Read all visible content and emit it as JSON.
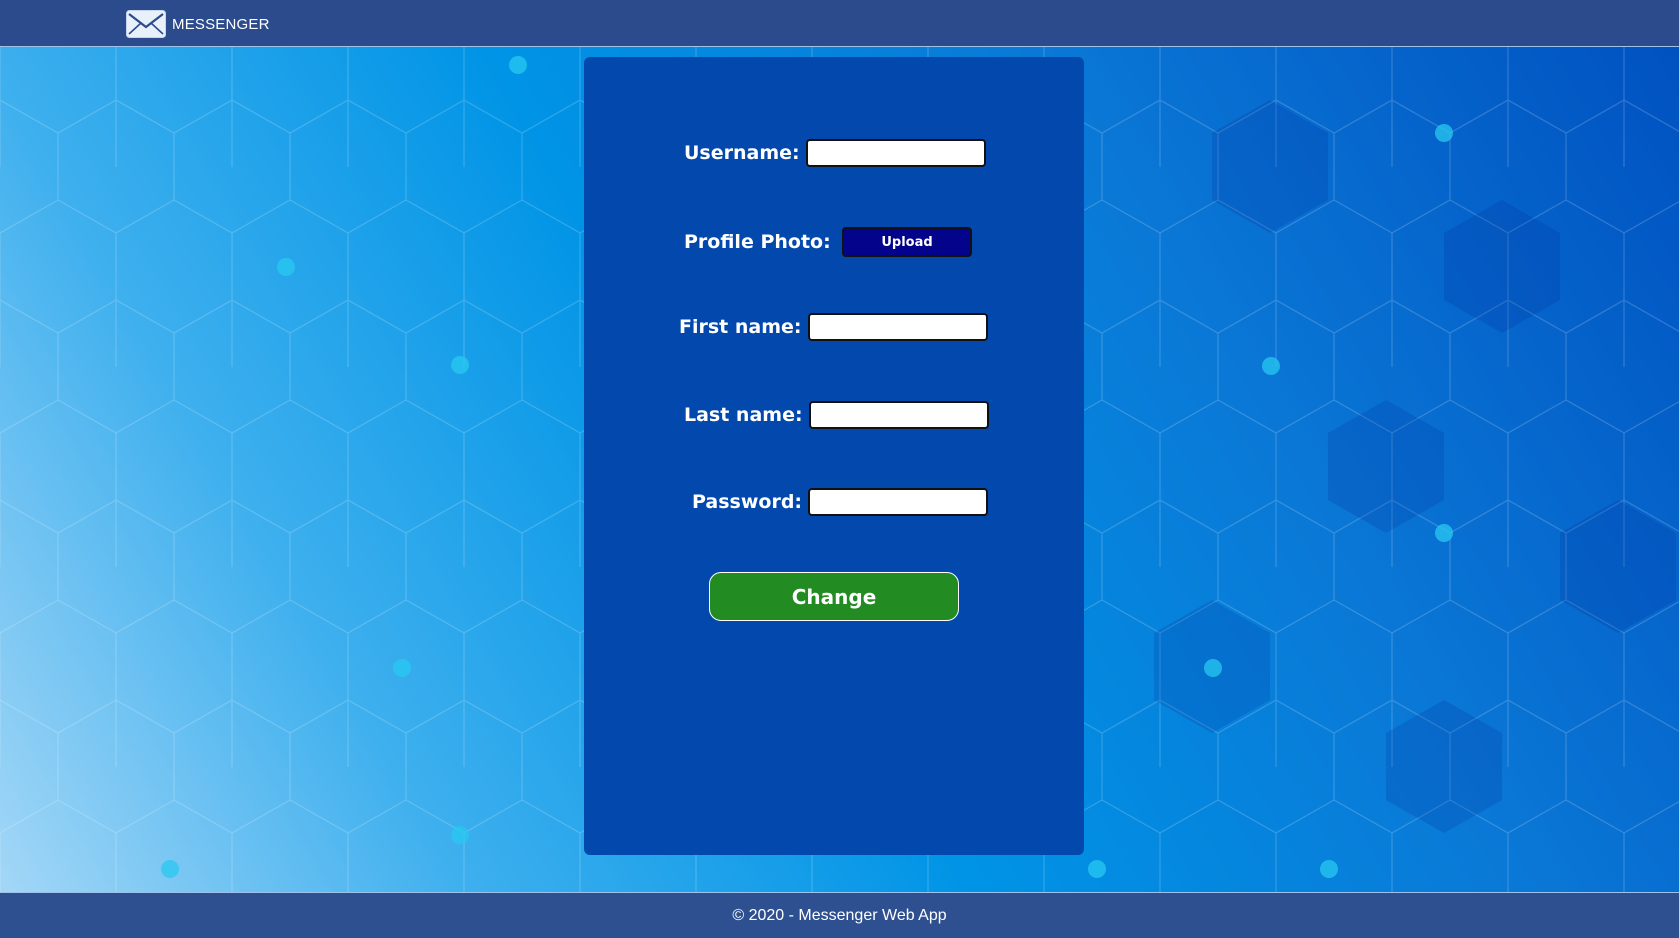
{
  "navbar": {
    "brand_text": "MESSENGER",
    "brand_icon": "envelope-icon"
  },
  "form": {
    "username_label": "Username:",
    "username_value": "",
    "profile_photo_label": "Profile Photo:",
    "upload_label": "Upload",
    "first_name_label": "First name:",
    "first_name_value": "",
    "last_name_label": "Last name:",
    "last_name_value": "",
    "password_label": "Password:",
    "password_value": "",
    "submit_label": "Change"
  },
  "footer": {
    "text": "© 2020 - Messenger Web App"
  },
  "colors": {
    "navbar": "#2b4b8d",
    "card": "#0349ad",
    "upload_button": "#03038c",
    "change_button": "#228b22",
    "footer": "#2e5090"
  }
}
